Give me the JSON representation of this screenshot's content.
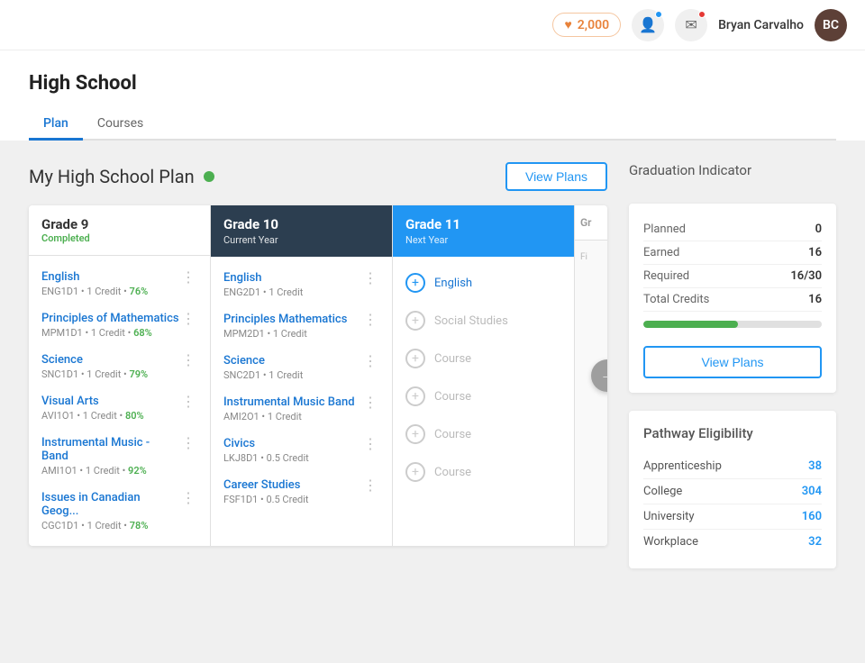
{
  "header": {
    "points": "2,000",
    "username": "Bryan Carvalho",
    "avatar_initials": "BC"
  },
  "page": {
    "title": "High School",
    "tabs": [
      {
        "label": "Plan",
        "active": true
      },
      {
        "label": "Courses",
        "active": false
      }
    ]
  },
  "plan": {
    "title": "My High School Plan",
    "view_plans_label": "View Plans"
  },
  "grades": [
    {
      "id": "grade9",
      "label": "Grade 9",
      "sub": "Completed",
      "theme": "light",
      "courses": [
        {
          "name": "English",
          "meta": "ENG1D1 • 1 Credit",
          "pct": "76%"
        },
        {
          "name": "Principles of Mathematics",
          "meta": "MPM1D1 • 1 Credit",
          "pct": "68%"
        },
        {
          "name": "Science",
          "meta": "SNC1D1 • 1 Credit",
          "pct": "79%"
        },
        {
          "name": "Visual Arts",
          "meta": "AVI1O1 • 1 Credit",
          "pct": "80%"
        },
        {
          "name": "Instrumental Music - Band",
          "meta": "AMI1O1 • 1 Credit",
          "pct": "92%"
        },
        {
          "name": "Issues in Canadian Geog...",
          "meta": "CGC1D1 • 1 Credit",
          "pct": "78%"
        }
      ]
    },
    {
      "id": "grade10",
      "label": "Grade 10",
      "sub": "Current Year",
      "theme": "dark",
      "courses": [
        {
          "name": "English",
          "meta": "ENG2D1 • 1 Credit",
          "pct": ""
        },
        {
          "name": "Principles Mathematics",
          "meta": "MPM2D1 • 1 Credit",
          "pct": ""
        },
        {
          "name": "Science",
          "meta": "SNC2D1 • 1 Credit",
          "pct": ""
        },
        {
          "name": "Instrumental Music - Band",
          "meta": "AMI2O1 • 1 Credit",
          "pct": ""
        },
        {
          "name": "Civics",
          "meta": "LKJ8D1 • 0.5 Credit",
          "pct": ""
        },
        {
          "name": "Career Studies",
          "meta": "FSF1D1 • 0.5 Credit",
          "pct": ""
        }
      ]
    },
    {
      "id": "grade11",
      "label": "Grade 11",
      "sub": "Next Year",
      "theme": "blue",
      "add_items": [
        {
          "label": "English",
          "active": true
        },
        {
          "label": "Social Studies",
          "active": false
        },
        {
          "label": "Course",
          "active": false
        },
        {
          "label": "Course",
          "active": false
        },
        {
          "label": "Course",
          "active": false
        },
        {
          "label": "Course",
          "active": false
        }
      ]
    },
    {
      "id": "grade_partial",
      "label": "Gr",
      "sub": "",
      "theme": "partial"
    }
  ],
  "graduation": {
    "title": "Graduation Indicator",
    "rows": [
      {
        "label": "Planned",
        "value": "0"
      },
      {
        "label": "Earned",
        "value": "16"
      },
      {
        "label": "Required",
        "value": "16/30"
      },
      {
        "label": "Total Credits",
        "value": "16"
      }
    ],
    "progress_pct": 53,
    "view_plans_label": "View Plans"
  },
  "pathway": {
    "title": "Pathway Eligibility",
    "rows": [
      {
        "label": "Apprenticeship",
        "value": "38"
      },
      {
        "label": "College",
        "value": "304"
      },
      {
        "label": "University",
        "value": "160"
      },
      {
        "label": "Workplace",
        "value": "32"
      }
    ]
  }
}
